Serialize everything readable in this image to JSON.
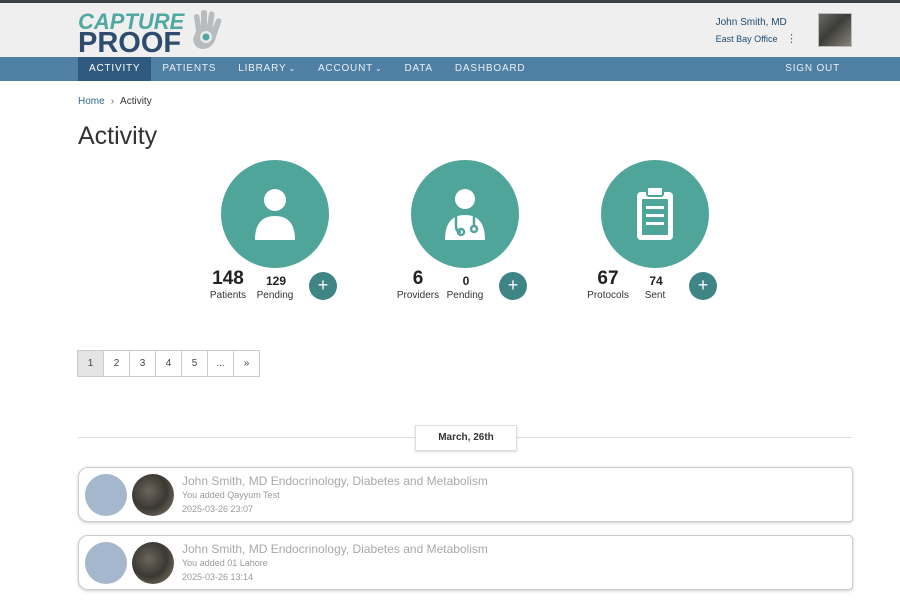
{
  "header": {
    "logo_top": "CAPTURE",
    "logo_bottom": "PROOF",
    "user_name": "John Smith, MD",
    "office": "East Bay Office",
    "kebab": "⋮"
  },
  "nav": {
    "items": [
      {
        "label": "ACTIVITY",
        "caret": ""
      },
      {
        "label": "PATIENTS",
        "caret": ""
      },
      {
        "label": "LIBRARY",
        "caret": "⌄"
      },
      {
        "label": "ACCOUNT",
        "caret": "⌄"
      },
      {
        "label": "DATA",
        "caret": ""
      },
      {
        "label": "DASHBOARD",
        "caret": ""
      }
    ],
    "signout": "SIGN OUT"
  },
  "breadcrumb": {
    "home": "Home",
    "sep": "›",
    "current": "Activity"
  },
  "page_title": "Activity",
  "stats": [
    {
      "icon": "person-icon",
      "count": "148",
      "count_label": "Patients",
      "pending": "129",
      "pending_label": "Pending",
      "add": "+"
    },
    {
      "icon": "doctor-icon",
      "count": "6",
      "count_label": "Providers",
      "pending": "0",
      "pending_label": "Pending",
      "add": "+"
    },
    {
      "icon": "clipboard-icon",
      "count": "67",
      "count_label": "Protocols",
      "pending": "74",
      "pending_label": "Sent",
      "add": "+"
    }
  ],
  "pagination": [
    "1",
    "2",
    "3",
    "4",
    "5",
    "...",
    "»"
  ],
  "activity_date": "March, 26th",
  "activities": [
    {
      "title": "John Smith, MD  Endocrinology, Diabetes and Metabolism",
      "desc": "You added Qayyum Test",
      "time": "2025-03-26 23:07"
    },
    {
      "title": "John Smith, MD  Endocrinology, Diabetes and Metabolism",
      "desc": "You added 01 Lahore",
      "time": "2025-03-26 13:14"
    }
  ],
  "colors": {
    "nav": "#4f7fa3",
    "nav_active": "#2d5a7e",
    "teal": "#4fa59a",
    "plus": "#3f8585"
  }
}
